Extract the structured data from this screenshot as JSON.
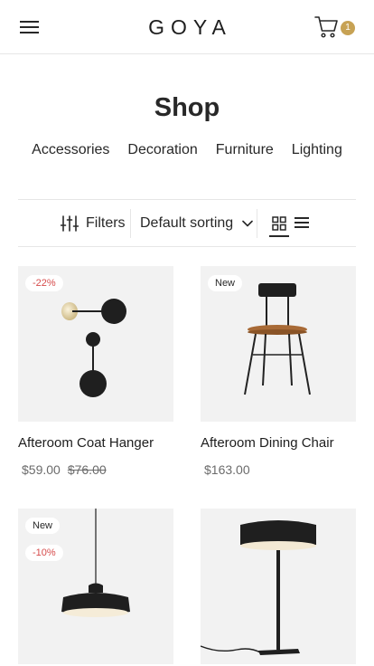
{
  "header": {
    "logo": "GOYA",
    "cart_count": "1"
  },
  "page": {
    "title": "Shop",
    "categories": [
      "Accessories",
      "Decoration",
      "Furniture",
      "Lighting"
    ]
  },
  "toolbar": {
    "filters_label": "Filters",
    "sorting_label": "Default sorting"
  },
  "products": [
    {
      "name": "Afteroom Coat Hanger",
      "price": "$59.00",
      "old_price": "$76.00",
      "badges": [
        "-22%"
      ]
    },
    {
      "name": "Afteroom Dining Chair",
      "price": "$163.00",
      "badges": [
        "New"
      ]
    },
    {
      "name": "",
      "price": "",
      "badges": [
        "New",
        "-10%"
      ]
    },
    {
      "name": "",
      "price": "",
      "badges": []
    }
  ]
}
